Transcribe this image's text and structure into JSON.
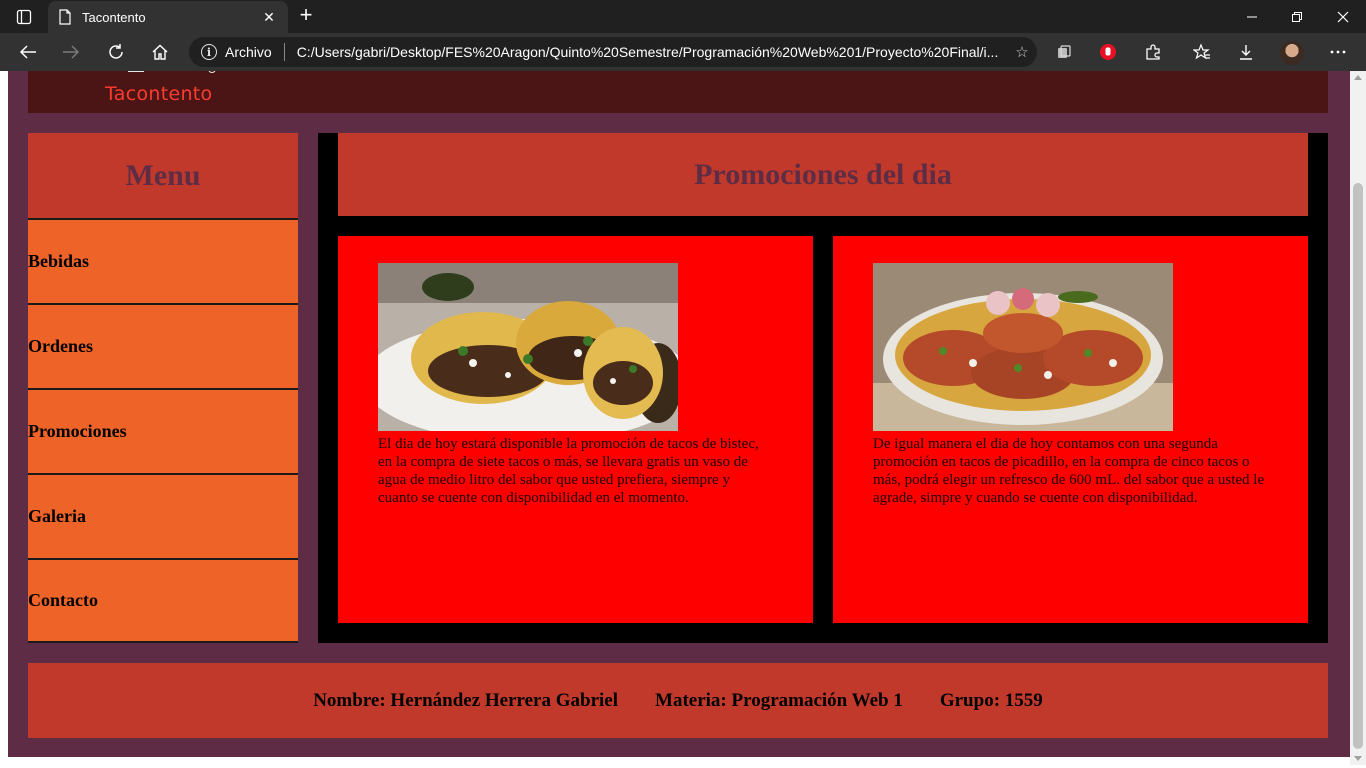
{
  "browser": {
    "tab_title": "Tacontento",
    "site_label": "Archivo",
    "url": "C:/Users/gabri/Desktop/FES%20Aragon/Quinto%20Semestre/Programación%20Web%201/Proyecto%20Final/i..."
  },
  "header": {
    "brand": "Tacontento"
  },
  "sidebar": {
    "title": "Menu",
    "items": [
      {
        "label": "Bebidas"
      },
      {
        "label": "Ordenes"
      },
      {
        "label": "Promociones"
      },
      {
        "label": "Galeria"
      },
      {
        "label": "Contacto"
      }
    ]
  },
  "main": {
    "title": "Promociones del dia",
    "promos": [
      {
        "image": "tacos-bistec-photo",
        "text": "El dia de hoy estará disponible la promoción de tacos de bistec, en la compra de siete tacos o más, se llevara gratis un vaso de agua de medio litro del sabor que usted prefiera, siempre y cuanto se cuente con disponibilidad en el momento."
      },
      {
        "image": "tacos-picadillo-photo",
        "text": "De igual manera el dia de hoy contamos con una segunda promoción en tacos de picadillo, en la compra de cinco tacos o más, podrá elegir un refresco de 600 mL. del sabor que a usted le agrade, simpre y cuando se cuente con disponibilidad."
      }
    ]
  },
  "footer": {
    "nombre": "Nombre: Hernández Herrera Gabriel",
    "materia": "Materia: Programación Web 1",
    "grupo": "Grupo: 1559"
  },
  "colors": {
    "page_bg": "#5e2d45",
    "header_bg": "#4a1514",
    "heading_bg": "#c0392b",
    "menu_item_bg": "#ee6327",
    "card_bg": "#ff0000",
    "brand_text": "#ff3b30"
  }
}
